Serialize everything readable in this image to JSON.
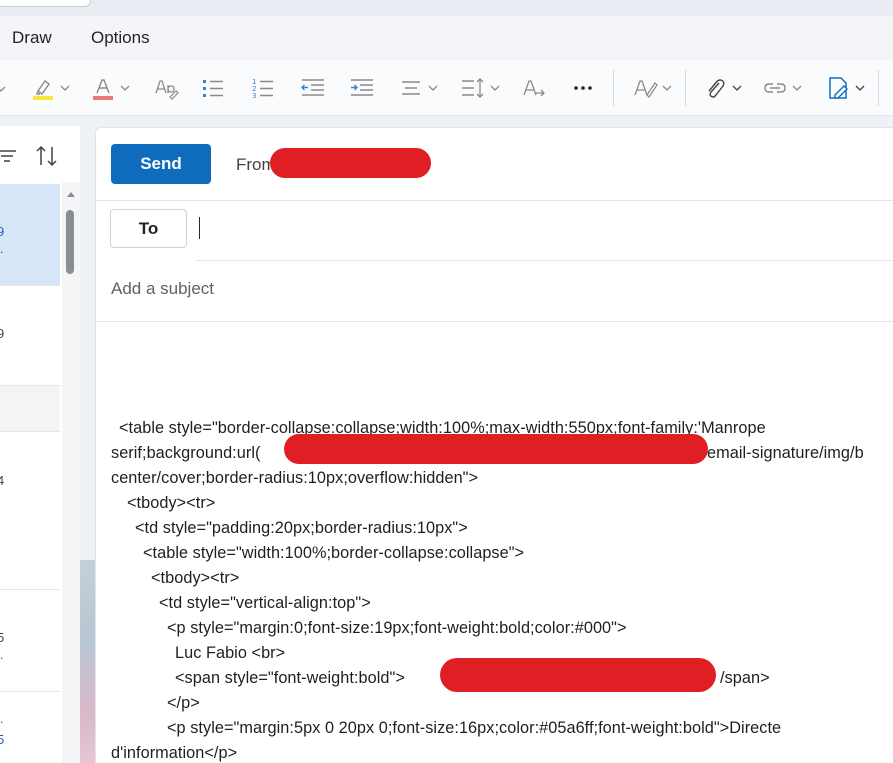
{
  "ribbon": {
    "tabs": [
      "Draw",
      "Options"
    ]
  },
  "toolbar": {
    "buttons": [
      "highlight-icon",
      "font-color-icon",
      "clear-formatting-icon",
      "bullets-icon",
      "numbering-icon",
      "decrease-indent-icon",
      "increase-indent-icon",
      "align-icon",
      "line-spacing-icon",
      "text-direction-icon",
      "more-icon",
      "editor-icon",
      "attach-icon",
      "link-icon",
      "signature-icon"
    ],
    "colors": {
      "highlight": "#f7e63c",
      "font_color": "#e8797a"
    }
  },
  "message_list": {
    "items": [
      {
        "digit": "9",
        "dot": ".",
        "selected": true,
        "digit_color": "#1f62b8"
      },
      {
        "digit": "9",
        "dot": "",
        "selected": false,
        "digit_color": "#444444"
      },
      {
        "digit": "4",
        "dot": "",
        "selected": false,
        "digit_color": "#444444"
      },
      {
        "digit": "5",
        "dot": ".",
        "selected": false,
        "digit_color": "#444444"
      },
      {
        "digit": "5",
        "dot": ".",
        "selected": false,
        "digit_color": "#1f62b8"
      }
    ]
  },
  "compose": {
    "send_label": "Send",
    "from_label": "From",
    "to_label": "To",
    "to_value": "",
    "subject_placeholder": "Add a subject",
    "body_lines": [
      "<table style=\"border-collapse:collapse;width:100%;max-width:550px;font-family:'Manrope",
      "serif;background:url(",
      "email-signature/img/b",
      "center/cover;border-radius:10px;overflow:hidden\">",
      "<tbody><tr>",
      "<td style=\"padding:20px;border-radius:10px\">",
      "<table style=\"width:100%;border-collapse:collapse\">",
      "<tbody><tr>",
      "<td style=\"vertical-align:top\">",
      "<p style=\"margin:0;font-size:19px;font-weight:bold;color:#000\">",
      "Luc Fabio <br>",
      "<span style=\"font-weight:bold\">",
      "/span>",
      "</p>",
      "<p style=\"margin:5px 0 20px 0;font-size:16px;color:#05a6ff;font-weight:bold\">Directe",
      "d'information</p>"
    ]
  },
  "colors": {
    "send_button": "#0f6cbd",
    "redaction": "#e01f25",
    "selected_item": "#d6e6f8"
  }
}
